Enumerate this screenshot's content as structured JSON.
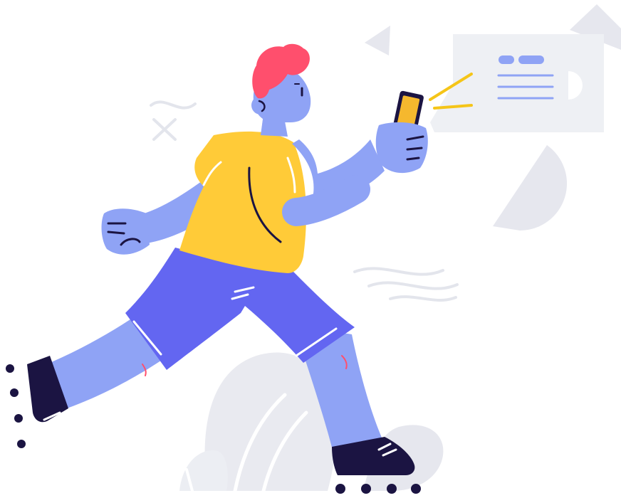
{
  "illustration": {
    "subject": "person-on-roller-skates-using-phone",
    "palette": {
      "background": "#ffffff",
      "shape_gray": "#e6e7ee",
      "shape_gray_light": "#eef0f4",
      "skin_blue": "#8fa3f5",
      "skin_shadow": "#7a8ff0",
      "shirt_yellow": "#ffcb38",
      "shorts_purple": "#6366f1",
      "hair_red": "#ff4f6d",
      "shoe_navy": "#1b1442",
      "phone_frame": "#1b1442",
      "phone_screen": "#f5b82e",
      "ray_yellow": "#f5c518",
      "card_accent": "#8fa3f5",
      "outline": "#1b1442",
      "doodle": "#e3e5ec"
    }
  }
}
